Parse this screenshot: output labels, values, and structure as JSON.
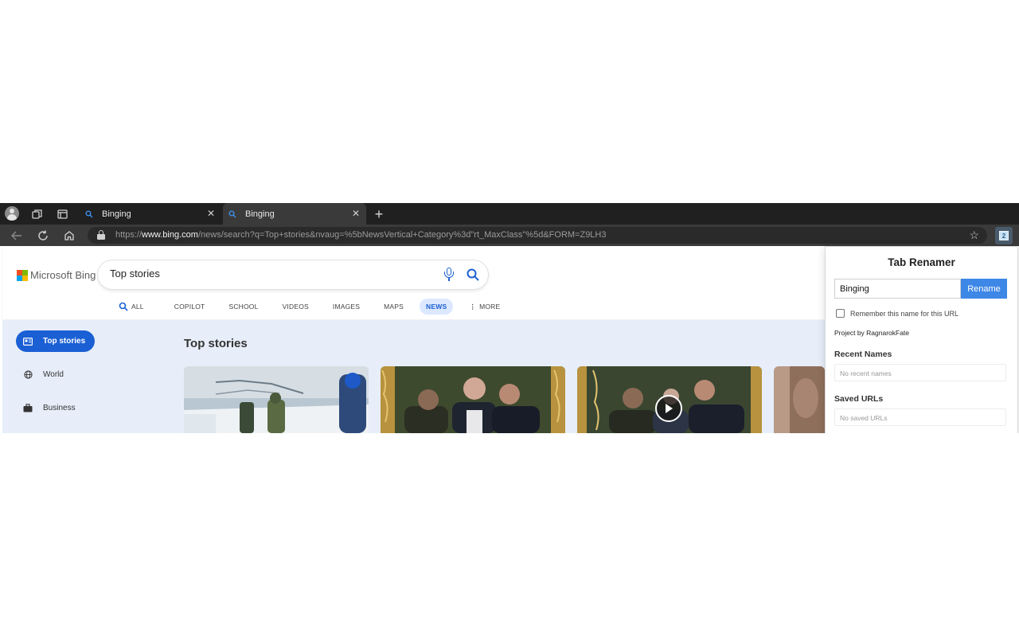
{
  "browser": {
    "tabs": [
      {
        "title": "Binging",
        "active": false
      },
      {
        "title": "Binging",
        "active": true
      }
    ],
    "url_prefix": "https://",
    "url_domain": "www.bing.com",
    "url_path": "/news/search?q=Top+stories&nvaug=%5bNewsVertical+Category%3d\"rt_MaxClass\"%5d&FORM=Z9LH3"
  },
  "bing": {
    "logo_text": "Microsoft Bing",
    "search_value": "Top stories",
    "scopes": [
      {
        "label": "ALL",
        "active": false
      },
      {
        "label": "COPILOT",
        "active": false
      },
      {
        "label": "SCHOOL",
        "active": false
      },
      {
        "label": "VIDEOS",
        "active": false
      },
      {
        "label": "IMAGES",
        "active": false
      },
      {
        "label": "MAPS",
        "active": false
      },
      {
        "label": "NEWS",
        "active": true
      },
      {
        "label": "MORE",
        "active": false
      }
    ],
    "sidebar": [
      {
        "label": "Top stories",
        "icon": "news-icon",
        "active": true
      },
      {
        "label": "World",
        "icon": "globe-icon",
        "active": false
      },
      {
        "label": "Business",
        "icon": "briefcase-icon",
        "active": false
      }
    ],
    "section_title": "Top stories"
  },
  "extension": {
    "title": "Tab Renamer",
    "name_value": "Binging",
    "rename_label": "Rename",
    "remember_label": "Remember this name for this URL",
    "remember_checked": false,
    "credit": "Project by RagnarokFate",
    "recent_label": "Recent Names",
    "recent_empty": "No recent names",
    "saved_label": "Saved URLs",
    "saved_empty": "No saved URLs"
  },
  "colors": {
    "accent": "#1a5fd4",
    "rename_button": "#3d87e6",
    "tabstrip": "#202020"
  }
}
